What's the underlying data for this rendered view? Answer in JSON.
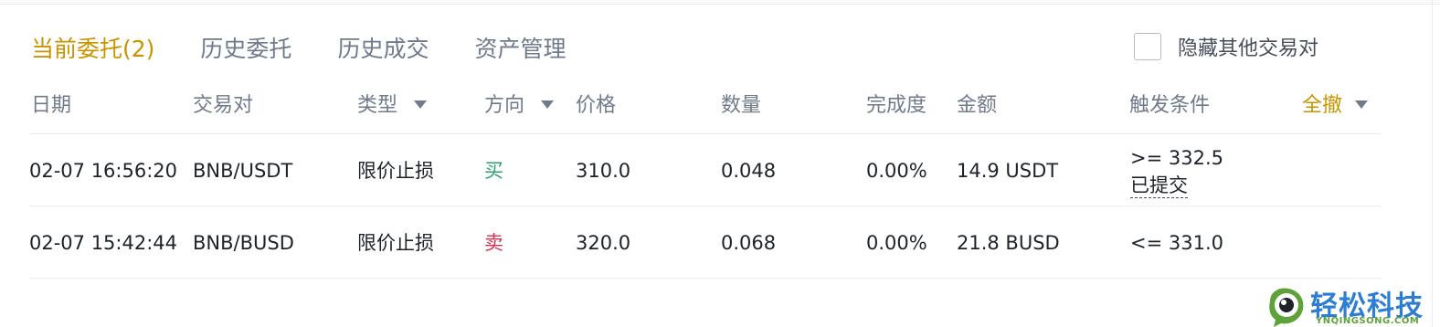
{
  "tabs": [
    {
      "label": "当前委托(2)",
      "active": true
    },
    {
      "label": "历史委托",
      "active": false
    },
    {
      "label": "历史成交",
      "active": false
    },
    {
      "label": "资产管理",
      "active": false
    }
  ],
  "hide_others": {
    "label": "隐藏其他交易对",
    "checked": false
  },
  "columns": {
    "date": "日期",
    "pair": "交易对",
    "type": "类型",
    "side": "方向",
    "price": "价格",
    "amount": "数量",
    "filled": "完成度",
    "total": "金额",
    "trigger": "触发条件",
    "cancel_all": "全撤"
  },
  "orders": [
    {
      "date": "02-07 16:56:20",
      "pair": "BNB/USDT",
      "type": "限价止损",
      "side": "买",
      "price": "310.0",
      "amount": "0.048",
      "filled": "0.00%",
      "total": "14.9 USDT",
      "trigger": ">= 332.5",
      "trigger_status": "已提交"
    },
    {
      "date": "02-07 15:42:44",
      "pair": "BNB/BUSD",
      "type": "限价止损",
      "side": "卖",
      "price": "320.0",
      "amount": "0.068",
      "filled": "0.00%",
      "total": "21.8 BUSD",
      "trigger": "<= 331.0",
      "trigger_status": ""
    }
  ],
  "colors": {
    "accent": "#c99400",
    "buy": "#2ea36b",
    "sell": "#d9304e",
    "muted": "#707a8a"
  },
  "watermark": {
    "title": "轻松科技",
    "subtitle": "YNQINGSONG.COM"
  }
}
